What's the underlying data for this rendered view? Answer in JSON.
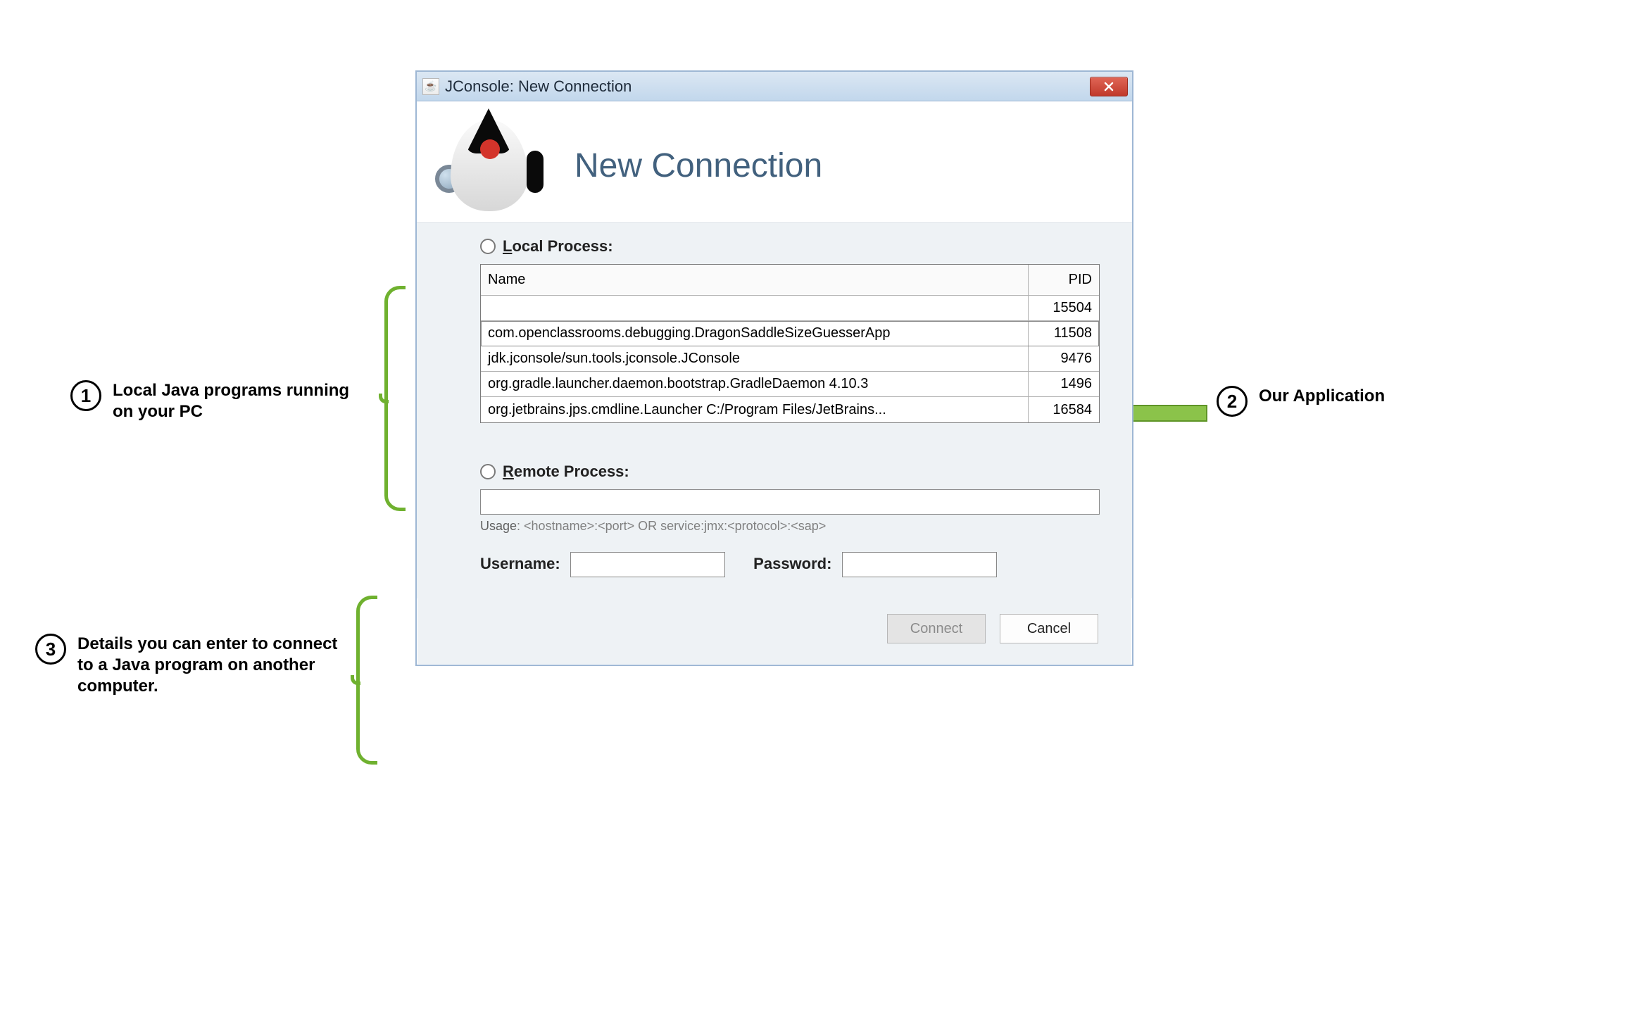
{
  "window": {
    "title": "JConsole: New Connection",
    "heading": "New Connection"
  },
  "local": {
    "label": "Local Process:",
    "col_name": "Name",
    "col_pid": "PID",
    "rows": [
      {
        "name": "",
        "pid": "15504",
        "selected": false
      },
      {
        "name": "com.openclassrooms.debugging.DragonSaddleSizeGuesserApp",
        "pid": "11508",
        "selected": true
      },
      {
        "name": "jdk.jconsole/sun.tools.jconsole.JConsole",
        "pid": "9476",
        "selected": false
      },
      {
        "name": "org.gradle.launcher.daemon.bootstrap.GradleDaemon 4.10.3",
        "pid": "1496",
        "selected": false
      },
      {
        "name": "org.jetbrains.jps.cmdline.Launcher C:/Program Files/JetBrains...",
        "pid": "16584",
        "selected": false
      }
    ]
  },
  "remote": {
    "label": "Remote Process:",
    "usage_label": "Usage",
    "usage_text": ": <hostname>:<port> OR service:jmx:<protocol>:<sap>",
    "username_label": "Username:",
    "password_label": "Password:"
  },
  "footer": {
    "connect": "Connect",
    "cancel": "Cancel"
  },
  "annotations": {
    "a1_num": "1",
    "a1_text": "Local Java programs running on your PC",
    "a2_num": "2",
    "a2_text": "Our Application",
    "a3_num": "3",
    "a3_text": "Details you can enter to connect to a Java program on another computer."
  }
}
